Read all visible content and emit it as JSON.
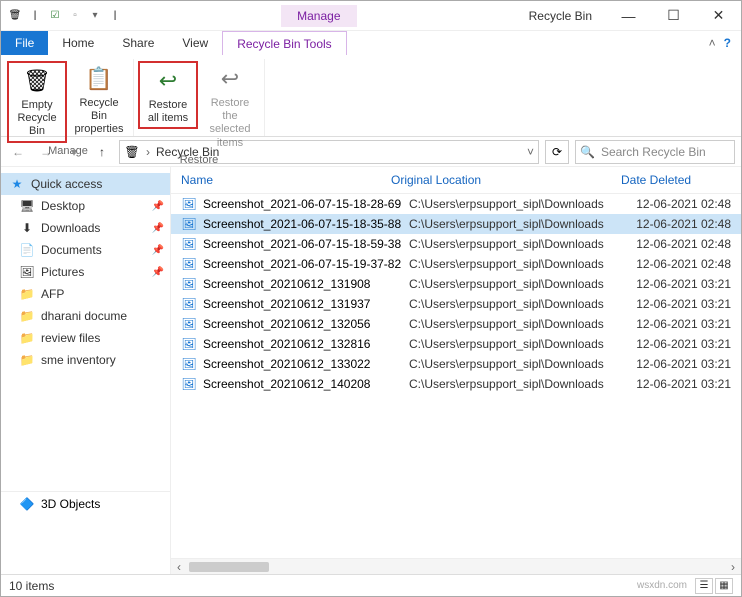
{
  "titlebar": {
    "context_tab": "Manage",
    "window_title": "Recycle Bin"
  },
  "tabs": {
    "file": "File",
    "home": "Home",
    "share": "Share",
    "view": "View",
    "tools": "Recycle Bin Tools"
  },
  "ribbon": {
    "empty": "Empty Recycle Bin",
    "properties": "Recycle Bin properties",
    "restore_all": "Restore all items",
    "restore_sel": "Restore the selected items",
    "group_manage": "Manage",
    "group_restore": "Restore"
  },
  "address": {
    "location": "Recycle Bin",
    "search_placeholder": "Search Recycle Bin"
  },
  "columns": {
    "name": "Name",
    "location": "Original Location",
    "deleted": "Date Deleted"
  },
  "sidebar": {
    "quick": "Quick access",
    "items": [
      {
        "label": "Desktop",
        "icon": "🖥",
        "pinned": true
      },
      {
        "label": "Downloads",
        "icon": "⬇",
        "pinned": true
      },
      {
        "label": "Documents",
        "icon": "📄",
        "pinned": true
      },
      {
        "label": "Pictures",
        "icon": "🖼",
        "pinned": true
      },
      {
        "label": "AFP",
        "icon": "📁",
        "pinned": false
      },
      {
        "label": "dharani docume",
        "icon": "📁",
        "pinned": false
      },
      {
        "label": "review files",
        "icon": "📁",
        "pinned": false
      },
      {
        "label": "sme inventory",
        "icon": "📁",
        "pinned": false
      }
    ],
    "bottom": "3D Objects"
  },
  "files": [
    {
      "name": "Screenshot_2021-06-07-15-18-28-69",
      "loc": "C:\\Users\\erpsupport_sipl\\Downloads",
      "date": "12-06-2021 02:48"
    },
    {
      "name": "Screenshot_2021-06-07-15-18-35-88",
      "loc": "C:\\Users\\erpsupport_sipl\\Downloads",
      "date": "12-06-2021 02:48",
      "selected": true
    },
    {
      "name": "Screenshot_2021-06-07-15-18-59-38",
      "loc": "C:\\Users\\erpsupport_sipl\\Downloads",
      "date": "12-06-2021 02:48"
    },
    {
      "name": "Screenshot_2021-06-07-15-19-37-82",
      "loc": "C:\\Users\\erpsupport_sipl\\Downloads",
      "date": "12-06-2021 02:48"
    },
    {
      "name": "Screenshot_20210612_131908",
      "loc": "C:\\Users\\erpsupport_sipl\\Downloads",
      "date": "12-06-2021 03:21"
    },
    {
      "name": "Screenshot_20210612_131937",
      "loc": "C:\\Users\\erpsupport_sipl\\Downloads",
      "date": "12-06-2021 03:21"
    },
    {
      "name": "Screenshot_20210612_132056",
      "loc": "C:\\Users\\erpsupport_sipl\\Downloads",
      "date": "12-06-2021 03:21"
    },
    {
      "name": "Screenshot_20210612_132816",
      "loc": "C:\\Users\\erpsupport_sipl\\Downloads",
      "date": "12-06-2021 03:21"
    },
    {
      "name": "Screenshot_20210612_133022",
      "loc": "C:\\Users\\erpsupport_sipl\\Downloads",
      "date": "12-06-2021 03:21"
    },
    {
      "name": "Screenshot_20210612_140208",
      "loc": "C:\\Users\\erpsupport_sipl\\Downloads",
      "date": "12-06-2021 03:21"
    }
  ],
  "status": {
    "count": "10 items",
    "watermark": "wsxdn.com"
  }
}
